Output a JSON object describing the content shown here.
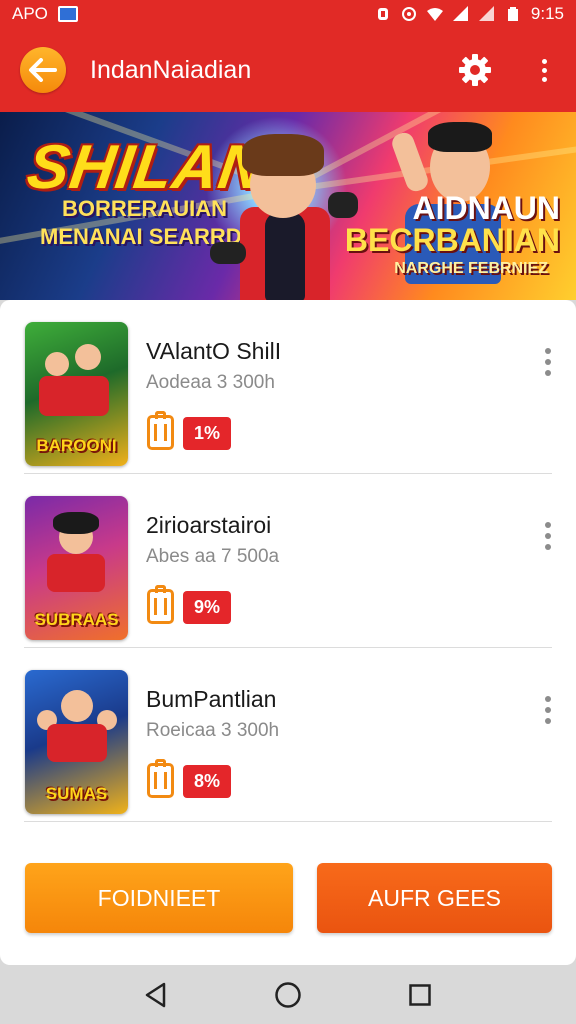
{
  "status_bar": {
    "left_text": "APO",
    "time": "9:15",
    "icons": [
      "app-notification-icon",
      "alarm-icon",
      "nfc-icon",
      "wifi-icon",
      "signal-icon",
      "signal-icon",
      "battery-icon"
    ]
  },
  "app_bar": {
    "title": "IndanNaiadian",
    "back_icon": "arrow-left-icon",
    "settings_icon": "gear-icon",
    "more_icon": "more-vertical-icon"
  },
  "banner": {
    "title": "SHILAN",
    "subtitle_line1": "BORRERAUIAN",
    "subtitle_line2": "MENANAI SEARRDIEN",
    "right_line1": "AIDNAUN",
    "right_line2": "BECRBANIAN",
    "right_line3": "NARGHE FEBRNIEZ"
  },
  "list": {
    "items": [
      {
        "title": "VAlantO ShilI",
        "subtitle": "Aodeaa 3 300h",
        "badge": "1%",
        "thumb_caption": "BAROONI",
        "thumb_colors": [
          "#2a7a2a",
          "#e8a21a"
        ]
      },
      {
        "title": "2irioarstairoi",
        "subtitle": "Abes aa 7 500a",
        "badge": "9%",
        "thumb_caption": "SUBRAAS",
        "thumb_colors": [
          "#6a2a9a",
          "#e84a2a"
        ]
      },
      {
        "title": "BumPantlian",
        "subtitle": "Roeicaa 3 300h",
        "badge": "8%",
        "thumb_caption": "SUMAS",
        "thumb_colors": [
          "#2a5aa8",
          "#f0b21a"
        ]
      }
    ]
  },
  "actions": {
    "left_label": "FOIDNIEET",
    "right_label": "AUFR GEES"
  },
  "nav": {
    "back_icon": "triangle-back-icon",
    "home_icon": "circle-home-icon",
    "recents_icon": "square-recents-icon"
  },
  "colors": {
    "primary": "#e12a26",
    "accent_orange": "#f5860a",
    "accent_red_orange": "#ea5410",
    "badge_red": "#e4262a"
  }
}
